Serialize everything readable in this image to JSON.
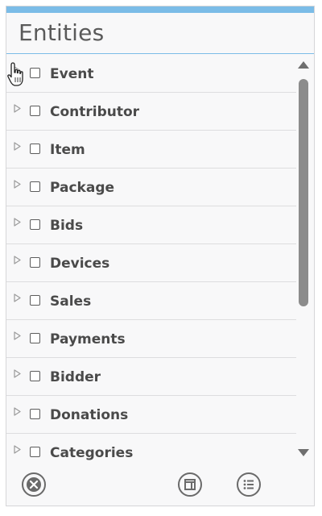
{
  "panel": {
    "title": "Entities"
  },
  "entities": [
    {
      "label": "Event",
      "checked": false,
      "expanded": false
    },
    {
      "label": "Contributor",
      "checked": false,
      "expanded": false
    },
    {
      "label": "Item",
      "checked": false,
      "expanded": false
    },
    {
      "label": "Package",
      "checked": false,
      "expanded": false
    },
    {
      "label": "Bids",
      "checked": false,
      "expanded": false
    },
    {
      "label": "Devices",
      "checked": false,
      "expanded": false
    },
    {
      "label": "Sales",
      "checked": false,
      "expanded": false
    },
    {
      "label": "Payments",
      "checked": false,
      "expanded": false
    },
    {
      "label": "Bidder",
      "checked": false,
      "expanded": false
    },
    {
      "label": "Donations",
      "checked": false,
      "expanded": false
    },
    {
      "label": "Categories",
      "checked": false,
      "expanded": false
    }
  ],
  "footer": {
    "buttons": [
      {
        "name": "clear-selection-button",
        "icon": "close-circle-icon"
      },
      {
        "name": "layout-button",
        "icon": "layout-panel-icon"
      },
      {
        "name": "list-options-button",
        "icon": "list-bullets-icon"
      }
    ]
  },
  "colors": {
    "accent": "#7bbce7",
    "text": "#4a4a4a",
    "panel_bg": "#f8f8f9",
    "scroll_thumb": "#8c8c8c"
  }
}
